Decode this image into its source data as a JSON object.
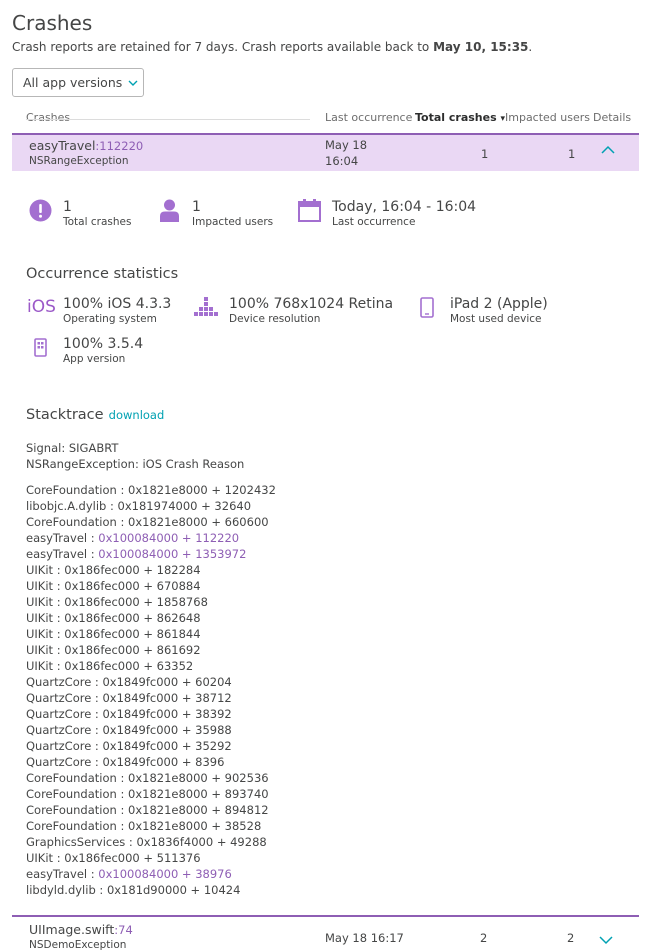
{
  "page": {
    "title": "Crashes",
    "subtitle_prefix": "Crash reports are retained for 7 days. Crash reports available back to ",
    "subtitle_date": "May 10, 15:35",
    "subtitle_suffix": "."
  },
  "filter": {
    "selected": "All app versions"
  },
  "table": {
    "headers": {
      "crashes": "Crashes",
      "last_occurrence": "Last occurrence",
      "total_crashes": "Total crashes",
      "sort_indicator": "▾",
      "impacted_users": "Impacted users",
      "details": "Details"
    },
    "rows": [
      {
        "name": "easyTravel",
        "line": ":112220",
        "exception": "NSRangeException",
        "date": "May 18",
        "time": "16:04",
        "total": "1",
        "users": "1"
      },
      {
        "name": "UIImage.swift",
        "line": ":74",
        "exception": "NSDemoException",
        "date_time": "May 18 16:17",
        "total": "2",
        "users": "2"
      }
    ]
  },
  "detail": {
    "summary": {
      "total_crashes_value": "1",
      "total_crashes_label": "Total crashes",
      "impacted_users_value": "1",
      "impacted_users_label": "Impacted users",
      "last_occurrence_value": "Today, 16:04 - 16:04",
      "last_occurrence_label": "Last occurrence"
    },
    "occurrence": {
      "heading": "Occurrence statistics",
      "os_icon_text": "iOS",
      "os_value": "100% iOS 4.3.3",
      "os_label": "Operating system",
      "res_value": "100% 768x1024 Retina",
      "res_label": "Device resolution",
      "device_value": "iPad 2 (Apple)",
      "device_label": "Most used device",
      "version_value": "100% 3.5.4",
      "version_label": "App version"
    },
    "stacktrace": {
      "heading": "Stacktrace",
      "download": "download",
      "signal": "Signal: SIGABRT",
      "reason": "NSRangeException: iOS Crash Reason",
      "frames": [
        {
          "module": "CoreFoundation",
          "addr": "0x1821e8000 + 1202432",
          "hl": false
        },
        {
          "module": "libobjc.A.dylib",
          "addr": "0x181974000 + 32640",
          "hl": false
        },
        {
          "module": "CoreFoundation",
          "addr": "0x1821e8000 + 660600",
          "hl": false
        },
        {
          "module": "easyTravel",
          "addr": "0x100084000 + 112220",
          "hl": true
        },
        {
          "module": "easyTravel",
          "addr": "0x100084000 + 1353972",
          "hl": true
        },
        {
          "module": "UIKit",
          "addr": "0x186fec000 + 182284",
          "hl": false
        },
        {
          "module": "UIKit",
          "addr": "0x186fec000 + 670884",
          "hl": false
        },
        {
          "module": "UIKit",
          "addr": "0x186fec000 + 1858768",
          "hl": false
        },
        {
          "module": "UIKit",
          "addr": "0x186fec000 + 862648",
          "hl": false
        },
        {
          "module": "UIKit",
          "addr": "0x186fec000 + 861844",
          "hl": false
        },
        {
          "module": "UIKit",
          "addr": "0x186fec000 + 861692",
          "hl": false
        },
        {
          "module": "UIKit",
          "addr": "0x186fec000 + 63352",
          "hl": false
        },
        {
          "module": "QuartzCore",
          "addr": "0x1849fc000 + 60204",
          "hl": false
        },
        {
          "module": "QuartzCore",
          "addr": "0x1849fc000 + 38712",
          "hl": false
        },
        {
          "module": "QuartzCore",
          "addr": "0x1849fc000 + 38392",
          "hl": false
        },
        {
          "module": "QuartzCore",
          "addr": "0x1849fc000 + 35988",
          "hl": false
        },
        {
          "module": "QuartzCore",
          "addr": "0x1849fc000 + 35292",
          "hl": false
        },
        {
          "module": "QuartzCore",
          "addr": "0x1849fc000 + 8396",
          "hl": false
        },
        {
          "module": "CoreFoundation",
          "addr": "0x1821e8000 + 902536",
          "hl": false
        },
        {
          "module": "CoreFoundation",
          "addr": "0x1821e8000 + 893740",
          "hl": false
        },
        {
          "module": "CoreFoundation",
          "addr": "0x1821e8000 + 894812",
          "hl": false
        },
        {
          "module": "CoreFoundation",
          "addr": "0x1821e8000 + 38528",
          "hl": false
        },
        {
          "module": "GraphicsServices",
          "addr": "0x1836f4000 + 49288",
          "hl": false
        },
        {
          "module": "UIKit",
          "addr": "0x186fec000 + 511376",
          "hl": false
        },
        {
          "module": "easyTravel",
          "addr": "0x100084000 + 38976",
          "hl": true
        },
        {
          "module": "libdyld.dylib",
          "addr": "0x181d90000 + 10424",
          "hl": false
        }
      ]
    }
  },
  "colors": {
    "accent": "#8e5eb4",
    "icon": "#a36fd0",
    "link": "#00a1b2",
    "selected_row": "#ead8f4"
  },
  "icons": {
    "expand_collapse": "chevron-up-icon",
    "expand": "chevron-down-icon",
    "select": "chevron-down-icon",
    "total_crashes": "alert-icon",
    "impacted_users": "user-icon",
    "last_occurrence": "calendar-icon",
    "resolution": "bars-icon",
    "device": "tablet-icon",
    "app_version": "app-icon"
  }
}
